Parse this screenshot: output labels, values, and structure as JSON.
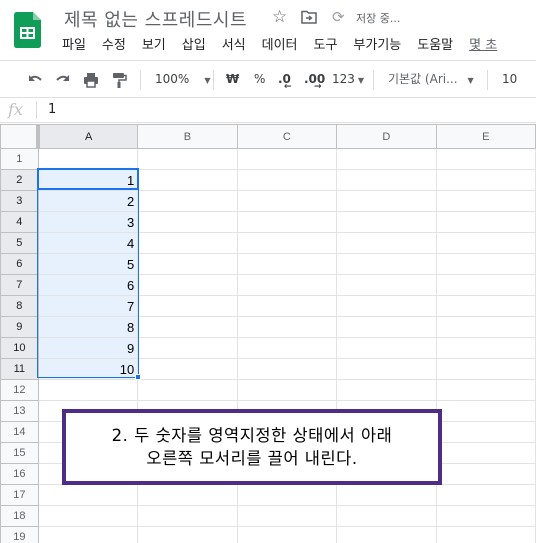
{
  "app": {
    "doc_title": "제목 없는 스프레드시트",
    "save_status": "저장 중...",
    "logo_icon": "sheets-logo-icon",
    "brand_color": "#0f9d58"
  },
  "menu": {
    "items": [
      "파일",
      "수정",
      "보기",
      "삽입",
      "서식",
      "데이터",
      "도구",
      "부가기능",
      "도움말"
    ],
    "last_edit_link": "몇 초"
  },
  "toolbar": {
    "zoom": "100%",
    "currency": "₩",
    "percent": "%",
    "decrease_decimal": ".0",
    "increase_decimal": ".00",
    "more_formats": "123",
    "font_family": "기본값 (Ari...",
    "font_size": "10"
  },
  "formula_bar": {
    "fx_label": "fx",
    "value": "1"
  },
  "grid": {
    "columns": [
      "A",
      "B",
      "C",
      "D",
      "E"
    ],
    "rows": [
      {
        "num": "1",
        "a": ""
      },
      {
        "num": "2",
        "a": "1"
      },
      {
        "num": "3",
        "a": "2"
      },
      {
        "num": "4",
        "a": "3"
      },
      {
        "num": "5",
        "a": "4"
      },
      {
        "num": "6",
        "a": "5"
      },
      {
        "num": "7",
        "a": "6"
      },
      {
        "num": "8",
        "a": "7"
      },
      {
        "num": "9",
        "a": "8"
      },
      {
        "num": "10",
        "a": "9"
      },
      {
        "num": "11",
        "a": "10"
      },
      {
        "num": "12",
        "a": ""
      },
      {
        "num": "13",
        "a": ""
      },
      {
        "num": "14",
        "a": ""
      },
      {
        "num": "15",
        "a": ""
      },
      {
        "num": "16",
        "a": ""
      },
      {
        "num": "17",
        "a": ""
      },
      {
        "num": "18",
        "a": ""
      },
      {
        "num": "19",
        "a": ""
      }
    ],
    "selection_range": "A2:A11",
    "selection_color": "#1a73e8"
  },
  "annotation": {
    "line1": "2. 두 숫자를 영역지정한 상태에서 아래",
    "line2": "오른쪽 모서리를 끌어 내린다.",
    "border_color": "#4f2d86"
  }
}
